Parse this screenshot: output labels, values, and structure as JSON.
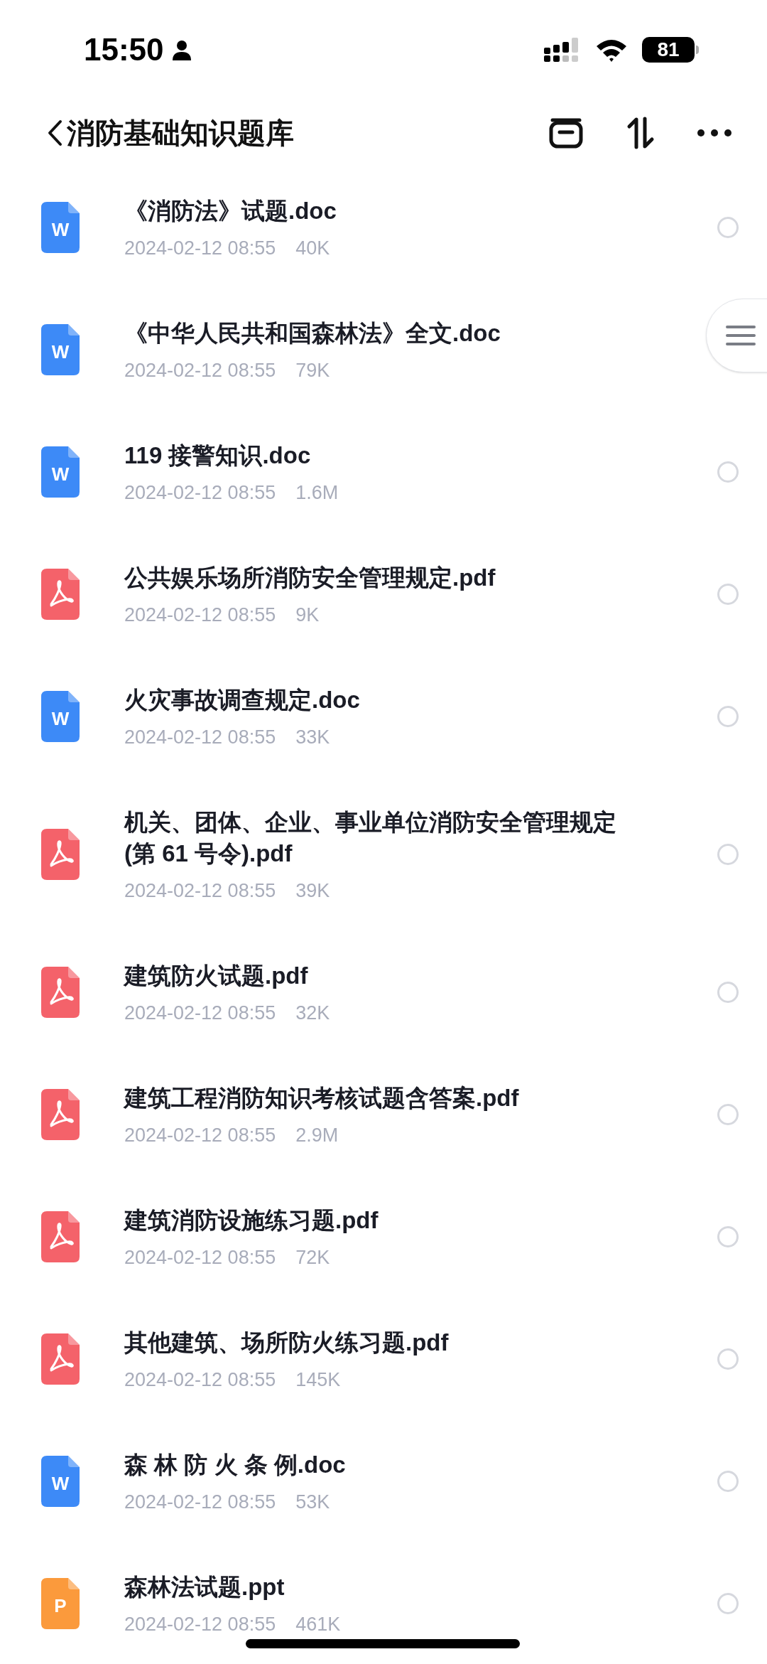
{
  "status_bar": {
    "time": "15:50",
    "battery": "81"
  },
  "header": {
    "title": "消防基础知识题库"
  },
  "files": [
    {
      "kind": "doc",
      "icon_text": "W",
      "name": "《消防法》试题.doc",
      "date": "2024-02-12 08:55",
      "size": "40K",
      "selected": false
    },
    {
      "kind": "doc",
      "icon_text": "W",
      "name": "《中华人民共和国森林法》全文.doc",
      "date": "2024-02-12 08:55",
      "size": "79K"
    },
    {
      "kind": "doc",
      "icon_text": "W",
      "name": "119 接警知识.doc",
      "date": "2024-02-12 08:55",
      "size": "1.6M",
      "selected": false
    },
    {
      "kind": "pdf",
      "name": "公共娱乐场所消防安全管理规定.pdf",
      "date": "2024-02-12 08:55",
      "size": "9K",
      "selected": false
    },
    {
      "kind": "doc",
      "icon_text": "W",
      "name": "火灾事故调查规定.doc",
      "date": "2024-02-12 08:55",
      "size": "33K",
      "selected": false
    },
    {
      "kind": "pdf",
      "name": "机关、团体、企业、事业单位消防安全管理规定 (第 61 号令).pdf",
      "date": "2024-02-12 08:55",
      "size": "39K",
      "selected": false
    },
    {
      "kind": "pdf",
      "name": "建筑防火试题.pdf",
      "date": "2024-02-12 08:55",
      "size": "32K",
      "selected": false
    },
    {
      "kind": "pdf",
      "name": "建筑工程消防知识考核试题含答案.pdf",
      "date": "2024-02-12 08:55",
      "size": "2.9M",
      "selected": false
    },
    {
      "kind": "pdf",
      "name": "建筑消防设施练习题.pdf",
      "date": "2024-02-12 08:55",
      "size": "72K",
      "selected": false
    },
    {
      "kind": "pdf",
      "name": "其他建筑、场所防火练习题.pdf",
      "date": "2024-02-12 08:55",
      "size": "145K",
      "selected": false
    },
    {
      "kind": "doc",
      "icon_text": "W",
      "name": "森 林 防 火 条 例.doc",
      "date": "2024-02-12 08:55",
      "size": "53K",
      "selected": false
    },
    {
      "kind": "ppt",
      "icon_text": "P",
      "name": "森林法试题.ppt",
      "date": "2024-02-12 08:55",
      "size": "461K",
      "selected": false
    }
  ]
}
